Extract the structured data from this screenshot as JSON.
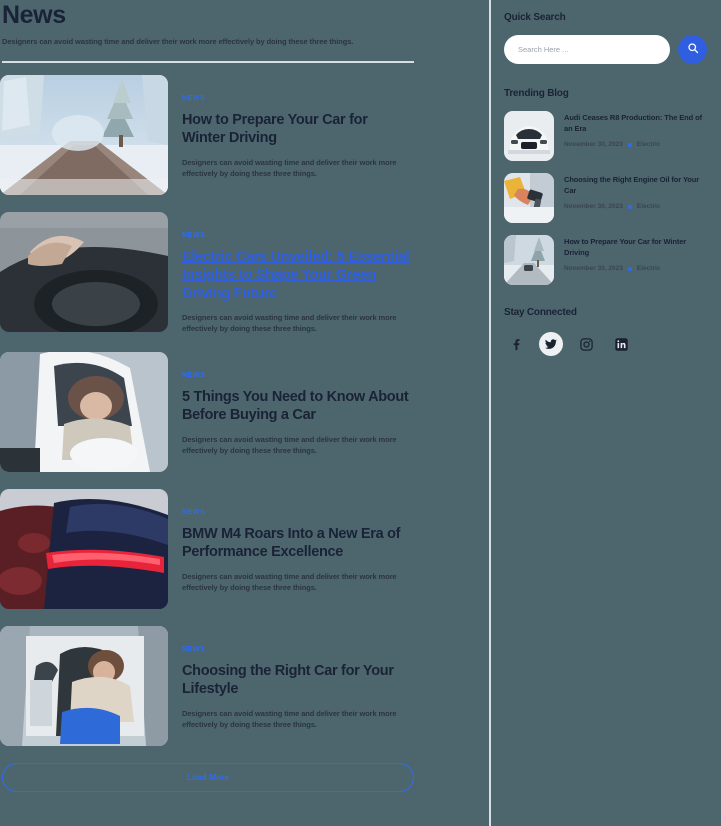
{
  "header": {
    "title": "News",
    "subtitle": "Designers can avoid wasting time and deliver their work more effectively by doing these three things."
  },
  "articles": [
    {
      "category": "NEWS",
      "title": "How to Prepare Your Car for Winter Driving",
      "excerpt": "Designers can avoid wasting time and deliver their work more effectively by doing these three things.",
      "image_alt": "snowy-forest-road"
    },
    {
      "category": "NEWS",
      "title": "Electric Cars Unveiled: 5 Essential Insights to Shape Your Green Driving Future",
      "excerpt": "Designers can avoid wasting time and deliver their work more effectively by doing these three things.",
      "image_alt": "hand-on-steering-wheel"
    },
    {
      "category": "NEWS",
      "title": "5 Things You Need to Know About Before Buying a Car",
      "excerpt": "Designers can avoid wasting time and deliver their work more effectively by doing these three things.",
      "image_alt": "woman-leaning-out-car-window"
    },
    {
      "category": "NEWS",
      "title": "BMW M4 Roars Into a New Era of Performance Excellence",
      "excerpt": "Designers can avoid wasting time and deliver their work more effectively by doing these three things.",
      "image_alt": "blue-car-taillight"
    },
    {
      "category": "NEWS",
      "title": "Choosing the Right Car for Your Lifestyle",
      "excerpt": "Designers can avoid wasting time and deliver their work more effectively by doing these three things.",
      "image_alt": "woman-sitting-in-car"
    }
  ],
  "load_more_label": "Load More",
  "sidebar": {
    "quick_search": {
      "heading": "Quick Search",
      "placeholder": "Search Here ...",
      "value": ""
    },
    "trending": {
      "heading": "Trending Blog",
      "items": [
        {
          "title": "Audi Ceases R8 Production: The End of an Era",
          "date": "November 30, 2023",
          "tag": "Electric",
          "image_alt": "white-audi-r8-front"
        },
        {
          "title": "Choosing the Right Engine Oil for Your Car",
          "date": "November 30, 2023",
          "tag": "Electric",
          "image_alt": "refueling-car-nozzle"
        },
        {
          "title": "How to Prepare Your Car for Winter Driving",
          "date": "November 30, 2023",
          "tag": "Electric",
          "image_alt": "snowy-road-winter"
        }
      ]
    },
    "stay_connected": {
      "heading": "Stay Connected",
      "socials": [
        {
          "name": "facebook",
          "active": false
        },
        {
          "name": "twitter",
          "active": true
        },
        {
          "name": "instagram",
          "active": false
        },
        {
          "name": "linkedin",
          "active": false
        }
      ]
    }
  },
  "colors": {
    "page_background": "#4d666e",
    "accent_blue": "#2f6bf0",
    "link_hover": "#2f5fe0",
    "heading_dark": "#1a2235",
    "divider": "#d9dee3"
  }
}
